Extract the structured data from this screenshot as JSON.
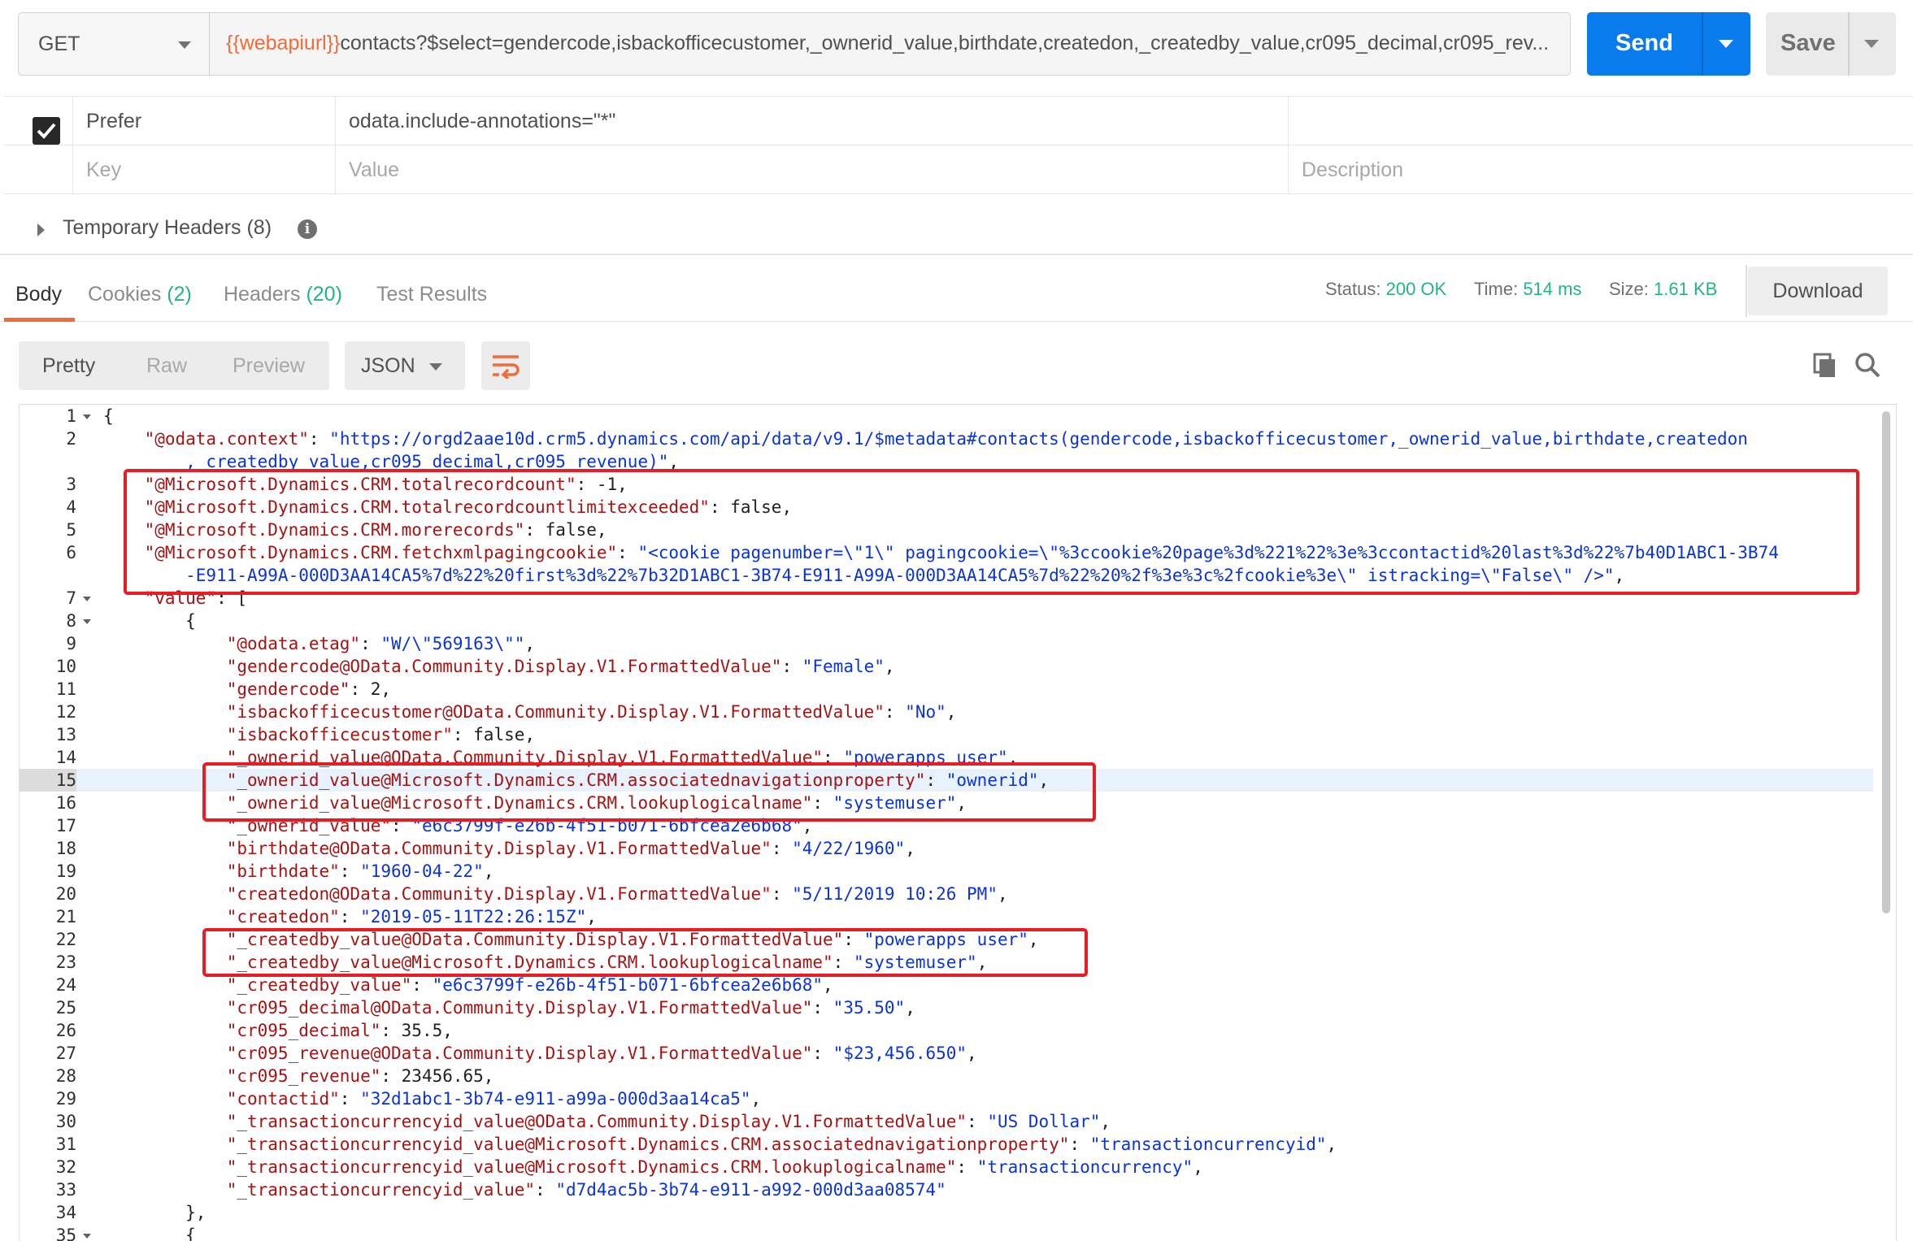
{
  "request": {
    "method": "GET",
    "url_var": "{{webapiurl}}",
    "url_rest": "contacts?$select=gendercode,isbackofficecustomer,_ownerid_value,birthdate,createdon,_createdby_value,cr095_decimal,cr095_rev...",
    "send_label": "Send",
    "save_label": "Save"
  },
  "headers": {
    "row": {
      "key": "Prefer",
      "value": "odata.include-annotations=\"*\"",
      "description": ""
    },
    "placeholder": {
      "key": "Key",
      "value": "Value",
      "description": "Description"
    },
    "temporary_label": "Temporary Headers (8)"
  },
  "response": {
    "tabs": [
      {
        "label": "Body",
        "count": ""
      },
      {
        "label": "Cookies",
        "count": "(2)"
      },
      {
        "label": "Headers",
        "count": "(20)"
      },
      {
        "label": "Test Results",
        "count": ""
      }
    ],
    "status_label": "Status:",
    "status_value": "200 OK",
    "time_label": "Time:",
    "time_value": "514 ms",
    "size_label": "Size:",
    "size_value": "1.61 KB",
    "download_label": "Download"
  },
  "view": {
    "modes": [
      "Pretty",
      "Raw",
      "Preview"
    ],
    "active_mode": "Pretty",
    "format": "JSON"
  },
  "icons": {
    "wrap": "wrap-lines-icon",
    "copy": "copy-icon",
    "search": "search-icon",
    "info": "info-icon"
  },
  "code_lines": [
    {
      "n": "1",
      "fold": true,
      "tokens": [
        [
          "p",
          "{"
        ]
      ]
    },
    {
      "n": "2",
      "fold": false,
      "tokens": [
        [
          "p",
          "    "
        ],
        [
          "k",
          "\"@odata.context\""
        ],
        [
          "p",
          ": "
        ],
        [
          "s",
          "\"https://orgd2aae10d.crm5.dynamics.com/api/data/v9.1/$metadata#contacts(gendercode,isbackofficecustomer,_ownerid_value,birthdate,createdon"
        ]
      ]
    },
    {
      "n": "",
      "fold": false,
      "tokens": [
        [
          "s",
          "        ,_createdby_value,cr095_decimal,cr095_revenue)\""
        ],
        [
          "p",
          ","
        ]
      ]
    },
    {
      "n": "3",
      "fold": false,
      "tokens": [
        [
          "p",
          "    "
        ],
        [
          "k",
          "\"@Microsoft.Dynamics.CRM.totalrecordcount\""
        ],
        [
          "p",
          ": -1,"
        ]
      ]
    },
    {
      "n": "4",
      "fold": false,
      "tokens": [
        [
          "p",
          "    "
        ],
        [
          "k",
          "\"@Microsoft.Dynamics.CRM.totalrecordcountlimitexceeded\""
        ],
        [
          "p",
          ": false,"
        ]
      ]
    },
    {
      "n": "5",
      "fold": false,
      "tokens": [
        [
          "p",
          "    "
        ],
        [
          "k",
          "\"@Microsoft.Dynamics.CRM.morerecords\""
        ],
        [
          "p",
          ": false,"
        ]
      ]
    },
    {
      "n": "6",
      "fold": false,
      "tokens": [
        [
          "p",
          "    "
        ],
        [
          "k",
          "\"@Microsoft.Dynamics.CRM.fetchxmlpagingcookie\""
        ],
        [
          "p",
          ": "
        ],
        [
          "s",
          "\"<cookie pagenumber=\\\"1\\\" pagingcookie=\\\"%3ccookie%20page%3d%221%22%3e%3ccontactid%20last%3d%22%7b40D1ABC1-3B74"
        ]
      ]
    },
    {
      "n": "",
      "fold": false,
      "tokens": [
        [
          "s",
          "        -E911-A99A-000D3AA14CA5%7d%22%20first%3d%22%7b32D1ABC1-3B74-E911-A99A-000D3AA14CA5%7d%22%20%2f%3e%3c%2fcookie%3e\\\" istracking=\\\"False\\\" />\""
        ],
        [
          "p",
          ","
        ]
      ]
    },
    {
      "n": "7",
      "fold": true,
      "tokens": [
        [
          "p",
          "    "
        ],
        [
          "k",
          "\"value\""
        ],
        [
          "p",
          ": ["
        ]
      ]
    },
    {
      "n": "8",
      "fold": true,
      "tokens": [
        [
          "p",
          "        {"
        ]
      ]
    },
    {
      "n": "9",
      "fold": false,
      "tokens": [
        [
          "p",
          "            "
        ],
        [
          "k",
          "\"@odata.etag\""
        ],
        [
          "p",
          ": "
        ],
        [
          "s",
          "\"W/\\\"569163\\\"\""
        ],
        [
          "p",
          ","
        ]
      ]
    },
    {
      "n": "10",
      "fold": false,
      "tokens": [
        [
          "p",
          "            "
        ],
        [
          "k",
          "\"gendercode@OData.Community.Display.V1.FormattedValue\""
        ],
        [
          "p",
          ": "
        ],
        [
          "s",
          "\"Female\""
        ],
        [
          "p",
          ","
        ]
      ]
    },
    {
      "n": "11",
      "fold": false,
      "tokens": [
        [
          "p",
          "            "
        ],
        [
          "k",
          "\"gendercode\""
        ],
        [
          "p",
          ": 2,"
        ]
      ]
    },
    {
      "n": "12",
      "fold": false,
      "tokens": [
        [
          "p",
          "            "
        ],
        [
          "k",
          "\"isbackofficecustomer@OData.Community.Display.V1.FormattedValue\""
        ],
        [
          "p",
          ": "
        ],
        [
          "s",
          "\"No\""
        ],
        [
          "p",
          ","
        ]
      ]
    },
    {
      "n": "13",
      "fold": false,
      "tokens": [
        [
          "p",
          "            "
        ],
        [
          "k",
          "\"isbackofficecustomer\""
        ],
        [
          "p",
          ": false,"
        ]
      ]
    },
    {
      "n": "14",
      "fold": false,
      "tokens": [
        [
          "p",
          "            "
        ],
        [
          "k",
          "\"_ownerid_value@OData.Community.Display.V1.FormattedValue\""
        ],
        [
          "p",
          ": "
        ],
        [
          "s",
          "\"powerapps user\""
        ],
        [
          "p",
          ","
        ]
      ]
    },
    {
      "n": "15",
      "fold": false,
      "hl": true,
      "tokens": [
        [
          "p",
          "            "
        ],
        [
          "k",
          "\"_ownerid_value@Microsoft.Dynamics.CRM.associatednavigationproperty\""
        ],
        [
          "p",
          ": "
        ],
        [
          "s",
          "\"ownerid\""
        ],
        [
          "p",
          ","
        ]
      ]
    },
    {
      "n": "16",
      "fold": false,
      "tokens": [
        [
          "p",
          "            "
        ],
        [
          "k",
          "\"_ownerid_value@Microsoft.Dynamics.CRM.lookuplogicalname\""
        ],
        [
          "p",
          ": "
        ],
        [
          "s",
          "\"systemuser\""
        ],
        [
          "p",
          ","
        ]
      ]
    },
    {
      "n": "17",
      "fold": false,
      "tokens": [
        [
          "p",
          "            "
        ],
        [
          "k",
          "\"_ownerid_value\""
        ],
        [
          "p",
          ": "
        ],
        [
          "s",
          "\"e6c3799f-e26b-4f51-b071-6bfcea2e6b68\""
        ],
        [
          "p",
          ","
        ]
      ]
    },
    {
      "n": "18",
      "fold": false,
      "tokens": [
        [
          "p",
          "            "
        ],
        [
          "k",
          "\"birthdate@OData.Community.Display.V1.FormattedValue\""
        ],
        [
          "p",
          ": "
        ],
        [
          "s",
          "\"4/22/1960\""
        ],
        [
          "p",
          ","
        ]
      ]
    },
    {
      "n": "19",
      "fold": false,
      "tokens": [
        [
          "p",
          "            "
        ],
        [
          "k",
          "\"birthdate\""
        ],
        [
          "p",
          ": "
        ],
        [
          "s",
          "\"1960-04-22\""
        ],
        [
          "p",
          ","
        ]
      ]
    },
    {
      "n": "20",
      "fold": false,
      "tokens": [
        [
          "p",
          "            "
        ],
        [
          "k",
          "\"createdon@OData.Community.Display.V1.FormattedValue\""
        ],
        [
          "p",
          ": "
        ],
        [
          "s",
          "\"5/11/2019 10:26 PM\""
        ],
        [
          "p",
          ","
        ]
      ]
    },
    {
      "n": "21",
      "fold": false,
      "tokens": [
        [
          "p",
          "            "
        ],
        [
          "k",
          "\"createdon\""
        ],
        [
          "p",
          ": "
        ],
        [
          "s",
          "\"2019-05-11T22:26:15Z\""
        ],
        [
          "p",
          ","
        ]
      ]
    },
    {
      "n": "22",
      "fold": false,
      "tokens": [
        [
          "p",
          "            "
        ],
        [
          "k",
          "\"_createdby_value@OData.Community.Display.V1.FormattedValue\""
        ],
        [
          "p",
          ": "
        ],
        [
          "s",
          "\"powerapps user\""
        ],
        [
          "p",
          ","
        ]
      ]
    },
    {
      "n": "23",
      "fold": false,
      "tokens": [
        [
          "p",
          "            "
        ],
        [
          "k",
          "\"_createdby_value@Microsoft.Dynamics.CRM.lookuplogicalname\""
        ],
        [
          "p",
          ": "
        ],
        [
          "s",
          "\"systemuser\""
        ],
        [
          "p",
          ","
        ]
      ]
    },
    {
      "n": "24",
      "fold": false,
      "tokens": [
        [
          "p",
          "            "
        ],
        [
          "k",
          "\"_createdby_value\""
        ],
        [
          "p",
          ": "
        ],
        [
          "s",
          "\"e6c3799f-e26b-4f51-b071-6bfcea2e6b68\""
        ],
        [
          "p",
          ","
        ]
      ]
    },
    {
      "n": "25",
      "fold": false,
      "tokens": [
        [
          "p",
          "            "
        ],
        [
          "k",
          "\"cr095_decimal@OData.Community.Display.V1.FormattedValue\""
        ],
        [
          "p",
          ": "
        ],
        [
          "s",
          "\"35.50\""
        ],
        [
          "p",
          ","
        ]
      ]
    },
    {
      "n": "26",
      "fold": false,
      "tokens": [
        [
          "p",
          "            "
        ],
        [
          "k",
          "\"cr095_decimal\""
        ],
        [
          "p",
          ": 35.5,"
        ]
      ]
    },
    {
      "n": "27",
      "fold": false,
      "tokens": [
        [
          "p",
          "            "
        ],
        [
          "k",
          "\"cr095_revenue@OData.Community.Display.V1.FormattedValue\""
        ],
        [
          "p",
          ": "
        ],
        [
          "s",
          "\"$23,456.650\""
        ],
        [
          "p",
          ","
        ]
      ]
    },
    {
      "n": "28",
      "fold": false,
      "tokens": [
        [
          "p",
          "            "
        ],
        [
          "k",
          "\"cr095_revenue\""
        ],
        [
          "p",
          ": 23456.65,"
        ]
      ]
    },
    {
      "n": "29",
      "fold": false,
      "tokens": [
        [
          "p",
          "            "
        ],
        [
          "k",
          "\"contactid\""
        ],
        [
          "p",
          ": "
        ],
        [
          "s",
          "\"32d1abc1-3b74-e911-a99a-000d3aa14ca5\""
        ],
        [
          "p",
          ","
        ]
      ]
    },
    {
      "n": "30",
      "fold": false,
      "tokens": [
        [
          "p",
          "            "
        ],
        [
          "k",
          "\"_transactioncurrencyid_value@OData.Community.Display.V1.FormattedValue\""
        ],
        [
          "p",
          ": "
        ],
        [
          "s",
          "\"US Dollar\""
        ],
        [
          "p",
          ","
        ]
      ]
    },
    {
      "n": "31",
      "fold": false,
      "tokens": [
        [
          "p",
          "            "
        ],
        [
          "k",
          "\"_transactioncurrencyid_value@Microsoft.Dynamics.CRM.associatednavigationproperty\""
        ],
        [
          "p",
          ": "
        ],
        [
          "s",
          "\"transactioncurrencyid\""
        ],
        [
          "p",
          ","
        ]
      ]
    },
    {
      "n": "32",
      "fold": false,
      "tokens": [
        [
          "p",
          "            "
        ],
        [
          "k",
          "\"_transactioncurrencyid_value@Microsoft.Dynamics.CRM.lookuplogicalname\""
        ],
        [
          "p",
          ": "
        ],
        [
          "s",
          "\"transactioncurrency\""
        ],
        [
          "p",
          ","
        ]
      ]
    },
    {
      "n": "33",
      "fold": false,
      "tokens": [
        [
          "p",
          "            "
        ],
        [
          "k",
          "\"_transactioncurrencyid_value\""
        ],
        [
          "p",
          ": "
        ],
        [
          "s",
          "\"d7d4ac5b-3b74-e911-a992-000d3aa08574\""
        ]
      ]
    },
    {
      "n": "34",
      "fold": false,
      "tokens": [
        [
          "p",
          "        },"
        ]
      ]
    },
    {
      "n": "35",
      "fold": true,
      "tokens": [
        [
          "p",
          "        {"
        ]
      ]
    }
  ]
}
